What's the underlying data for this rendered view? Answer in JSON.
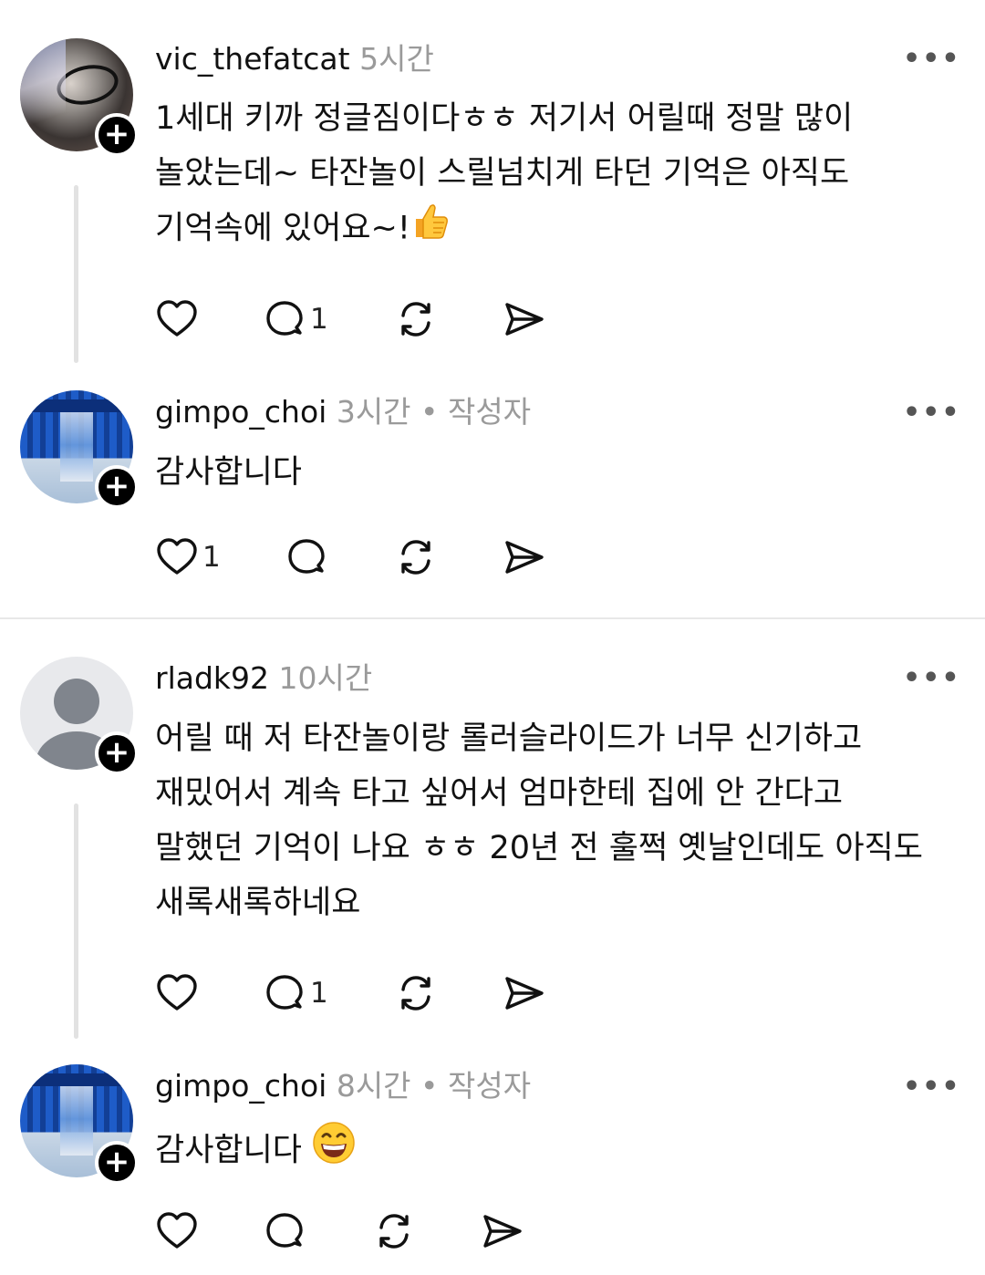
{
  "comments": [
    {
      "username": "vic_thefatcat",
      "time": "5시간",
      "text": "1세대 키까 정글짐이다ㅎㅎ 저기서 어릴때 정말 많이\n놀았는데~ 타잔놀이 스릴넘치게 타던 기억은 아직도\n기억속에 있어요~!",
      "emoji": "thumbs-up",
      "like_count": "",
      "reply_count": "1"
    },
    {
      "username": "gimpo_choi",
      "time": "3시간",
      "dot": "•",
      "author_label": "작성자",
      "text": "감사합니다",
      "like_count": "1",
      "reply_count": ""
    },
    {
      "username": "rladk92",
      "time": "10시간",
      "text": "어릴 때 저 타잔놀이랑 롤러슬라이드가 너무 신기하고\n재밌어서 계속 타고 싶어서 엄마한테 집에 안 간다고\n말했던 기억이 나요 ㅎㅎ 20년 전 훌쩍 옛날인데도 아직도\n새록새록하네요",
      "like_count": "",
      "reply_count": "1"
    },
    {
      "username": "gimpo_choi",
      "time": "8시간",
      "dot": "•",
      "author_label": "작성자",
      "text": "감사합니다 ",
      "emoji": "grinning-face",
      "like_count": "",
      "reply_count": ""
    }
  ],
  "icons": {
    "like": "heart-icon",
    "reply": "comment-icon",
    "repost": "repost-icon",
    "share": "send-icon",
    "more": "more-icon",
    "follow": "plus-icon"
  },
  "colors": {
    "text": "#111111",
    "muted": "#9a9a9a",
    "thread_line": "#e2e2e2"
  }
}
